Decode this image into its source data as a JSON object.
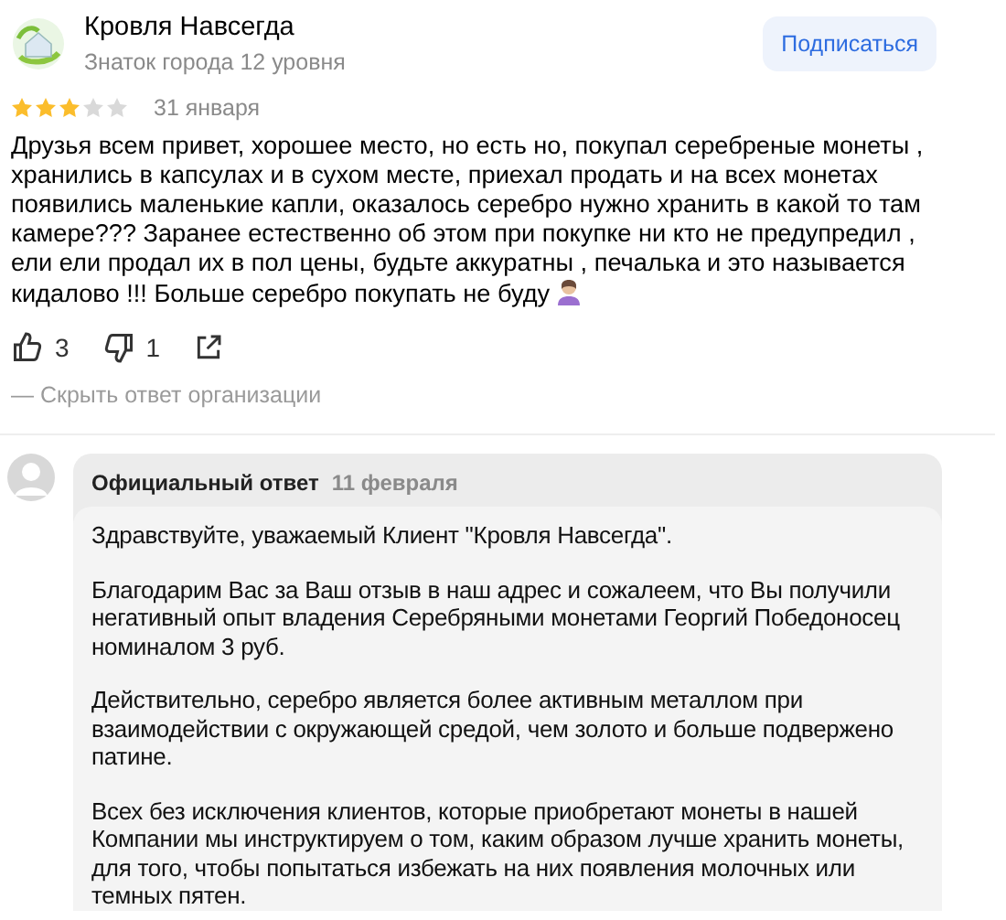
{
  "author": {
    "name": "Кровля Навсегда",
    "subtitle": "Знаток города 12 уровня"
  },
  "subscribe_button": "Подписаться",
  "review": {
    "stars": 3,
    "date": "31 января",
    "text": "Друзья всем привет, хорошее место, но есть но, покупал серебреные монеты , хранились в капсулах и в сухом месте, приехал продать и на всех монетах появились маленькие капли, оказалось серебро нужно хранить в какой то там камере??? Заранее естественно об этом при покупке ни кто не предупредил , ели ели продал их в пол цены, будьте аккуратны , печалька и это называется кидалово !!! Больше серебро покупать не буду"
  },
  "reactions": {
    "likes": "3",
    "dislikes": "1"
  },
  "hide_response_link": "— Скрыть ответ организации",
  "response": {
    "title": "Официальный ответ",
    "date": "11 февраля",
    "paragraphs": [
      "Здравствуйте, уважаемый Клиент \"Кровля Навсегда\".",
      "Благодарим Вас за Ваш отзыв в наш адрес и сожалеем, что Вы получили негативный опыт владения Серебряными монетами Георгий Победоносец номиналом 3 руб.",
      "Действительно, серебро является более активным металлом при взаимодействии с окружающей средой, чем золото и больше подвержено патине.",
      "Всех без исключения клиентов, которые приобретают монеты в нашей Компании  мы инструктируем о том, каким образом лучше хранить монеты, для того, чтобы попытаться избежать на них появления молочных или темных пятен."
    ]
  }
}
